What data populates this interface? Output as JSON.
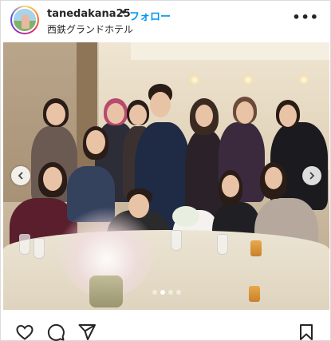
{
  "post": {
    "username": "tanedakana25",
    "separator": "•",
    "follow_label": "フォロー",
    "location": "西鉄グランドホテル",
    "more_label": "•••"
  },
  "icons": {
    "more": "more-options-icon",
    "prev": "chevron-left-icon",
    "next": "chevron-right-icon",
    "like": "heart-icon",
    "comment": "comment-icon",
    "share": "send-icon",
    "save": "bookmark-icon"
  },
  "carousel": {
    "slide_count": 4,
    "current_slide": 2
  },
  "colors": {
    "follow": "#0095f6",
    "text": "#262626",
    "border": "#dbdbdb"
  }
}
